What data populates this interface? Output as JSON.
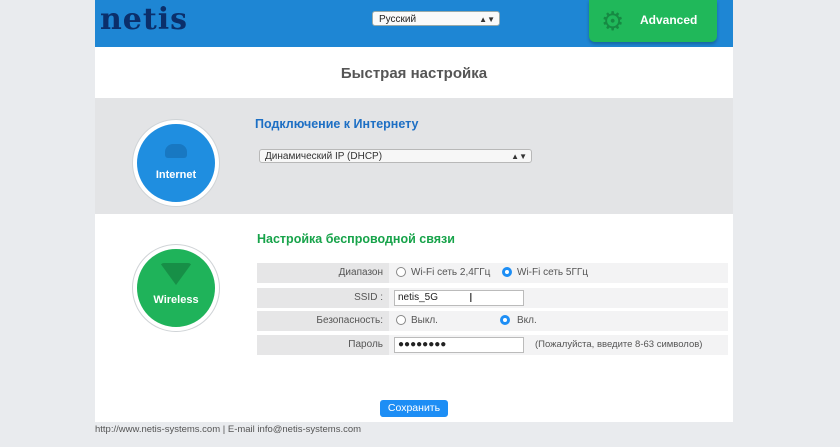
{
  "header": {
    "logo": "netis",
    "language": "Русский",
    "advanced_label": "Advanced",
    "colors": {
      "bar": "#1e86d4",
      "advanced": "#20b85a"
    }
  },
  "page": {
    "title": "Быстрая настройка",
    "save_label": "Сохранить"
  },
  "internet": {
    "circle_label": "Internet",
    "heading": "Подключение к Интернету",
    "connection_type": "Динамический IP (DHCP)",
    "icon": "cloud-icon"
  },
  "wireless": {
    "circle_label": "Wireless",
    "heading": "Настройка беспроводной связи",
    "icon": "wifi-icon",
    "band": {
      "label": "Диапазон",
      "options": [
        "Wi-Fi сеть 2,4ГГц",
        "Wi-Fi сеть 5ГГц"
      ],
      "selected": 1
    },
    "ssid": {
      "label": "SSID :",
      "value": "netis_5G"
    },
    "security": {
      "label": "Безопасность:",
      "options": [
        "Выкл.",
        "Вкл."
      ],
      "selected": 1
    },
    "password": {
      "label": "Пароль",
      "value": "●●●●●●●●",
      "hint": "(Пожалуйста, введите 8-63 символов)"
    }
  },
  "footer": {
    "text": "http://www.netis-systems.com | E-mail info@netis-systems.com"
  }
}
